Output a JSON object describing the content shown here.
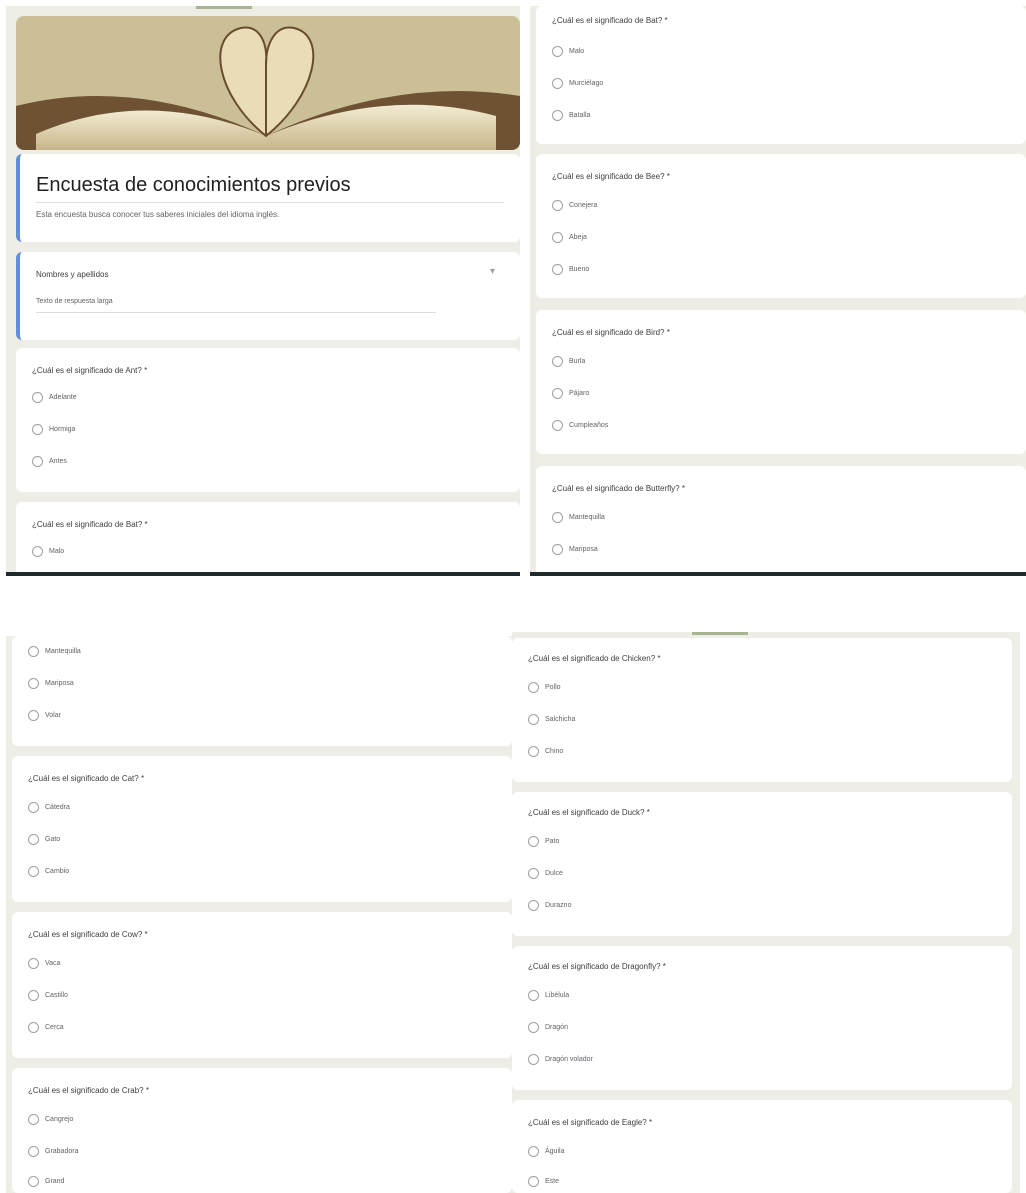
{
  "form": {
    "title": "Encuesta de conocimientos previos",
    "description": "Esta encuesta busca conocer tus saberes iniciales del idioma inglés.",
    "name_question": "Nombres y apellidos",
    "name_placeholder": "Texto de respuesta larga"
  },
  "questions": [
    {
      "q": "¿Cuál es el significado de Ant? *",
      "options": [
        "Adelante",
        "Hormiga",
        "Antes"
      ]
    },
    {
      "q": "¿Cuál es el significado de Bat? *",
      "options": [
        "Malo",
        "Murciélago",
        "Batalla"
      ]
    },
    {
      "q": "¿Cuál es el significado de Bee? *",
      "options": [
        "Conejera",
        "Abeja",
        "Bueno"
      ]
    },
    {
      "q": "¿Cuál es el significado de Bird? *",
      "options": [
        "Burla",
        "Pájaro",
        "Cumpleaños"
      ]
    },
    {
      "q": "¿Cuál es el significado de Butterfly? *",
      "options": [
        "Mantequilla",
        "Mariposa",
        "Volar"
      ]
    },
    {
      "q": "¿Cuál es el significado de Cat? *",
      "options": [
        "Cátedra",
        "Gato",
        "Cambio"
      ]
    },
    {
      "q": "¿Cuál es el significado de Cow? *",
      "options": [
        "Vaca",
        "Castillo",
        "Cerca"
      ]
    },
    {
      "q": "¿Cuál es el significado de Crab? *",
      "options": [
        "Cangrejo",
        "Grabadora",
        "Grand"
      ]
    },
    {
      "q": "¿Cuál es el significado de Chicken? *",
      "options": [
        "Pollo",
        "Salchicha",
        "Chino"
      ]
    },
    {
      "q": "¿Cuál es el significado de Duck? *",
      "options": [
        "Pato",
        "Dulce",
        "Durazno"
      ]
    },
    {
      "q": "¿Cuál es el significado de Dragonfly? *",
      "options": [
        "Libélula",
        "Dragón",
        "Dragón volador"
      ]
    },
    {
      "q": "¿Cuál es el significado de Eagle? *",
      "options": [
        "Águila",
        "Este"
      ]
    }
  ],
  "colors": {
    "accent": "#5f8fd6",
    "background": "#efeee6",
    "card": "#ffffff"
  }
}
